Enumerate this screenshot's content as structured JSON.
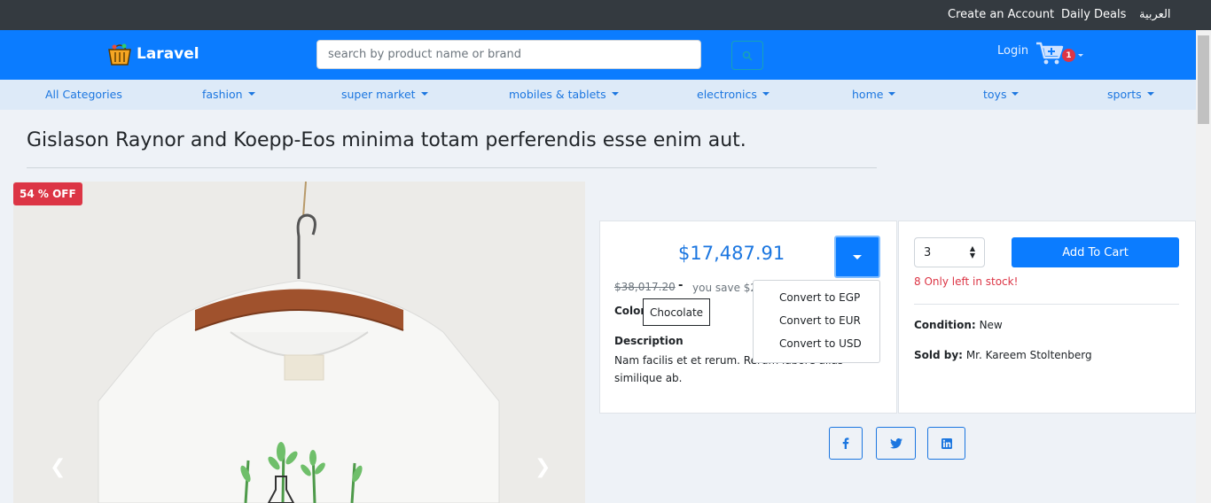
{
  "topbar": {
    "create_account": "Create an Account",
    "daily_deals": "Daily Deals",
    "language": "العربية"
  },
  "header": {
    "logo_text": "Laravel",
    "search_placeholder": "search by product name or brand",
    "login": "Login",
    "cart_count": "1"
  },
  "categories": [
    {
      "label": "All Categories",
      "dropdown": false
    },
    {
      "label": "fashion",
      "dropdown": true
    },
    {
      "label": "super market",
      "dropdown": true
    },
    {
      "label": "mobiles & tablets",
      "dropdown": true
    },
    {
      "label": "electronics",
      "dropdown": true
    },
    {
      "label": "home",
      "dropdown": true
    },
    {
      "label": "toys",
      "dropdown": true
    },
    {
      "label": "sports",
      "dropdown": true
    }
  ],
  "product": {
    "title": "Gislason Raynor and Koepp-Eos minima totam perferendis esse enim aut.",
    "discount_badge": "54 % OFF",
    "price": "$17,487.91",
    "old_price": "$38,017.20",
    "dash": "-",
    "you_save": "you save $20",
    "color_label": "Color:",
    "color_value": "Chocolate",
    "description_label": "Description",
    "description_text": "Nam facilis et et rerum. Rerum labore alias similique ab."
  },
  "currency_menu": {
    "options": [
      "Convert to EGP",
      "Convert to EUR",
      "Convert to USD"
    ]
  },
  "purchase": {
    "quantity": "3",
    "add_to_cart": "Add To Cart",
    "stock": "8 Only left in stock!",
    "condition_label": "Condition:",
    "condition_value": "New",
    "sold_by_label": "Sold by:",
    "sold_by_value": "Mr. Kareem Stoltenberg"
  },
  "colors": {
    "brand_blue": "#0b7cff",
    "topbar": "#343a40",
    "danger": "#dc3545",
    "link": "#1b76e0"
  }
}
